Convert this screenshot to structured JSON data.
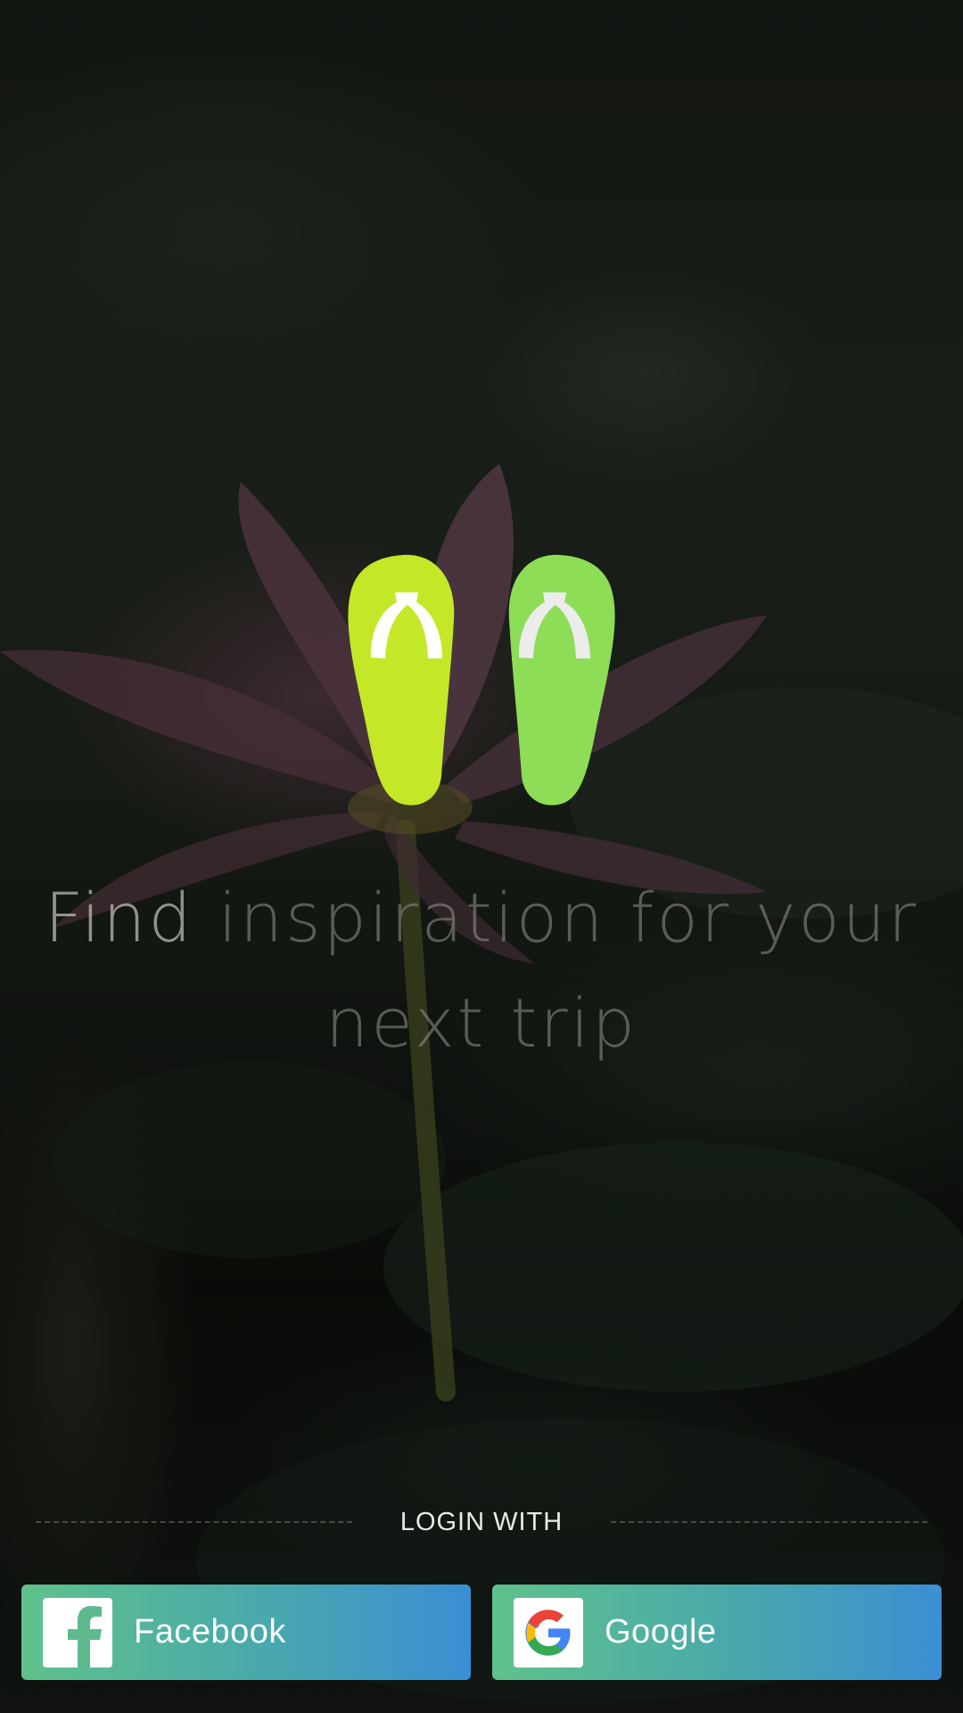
{
  "tagline": {
    "lead": "Find",
    "rest_line1": " inspiration for your",
    "line2": "next trip"
  },
  "login": {
    "divider_label": "LOGIN WITH",
    "facebook": {
      "label": "Facebook",
      "icon": "facebook-icon"
    },
    "google": {
      "label": "Google",
      "icon": "google-icon"
    }
  },
  "colors": {
    "flipflop_left": "#c4e827",
    "flipflop_right": "#8ddd57",
    "button_gradient_start": "#5fc28b",
    "button_gradient_end": "#3a8fd4"
  }
}
